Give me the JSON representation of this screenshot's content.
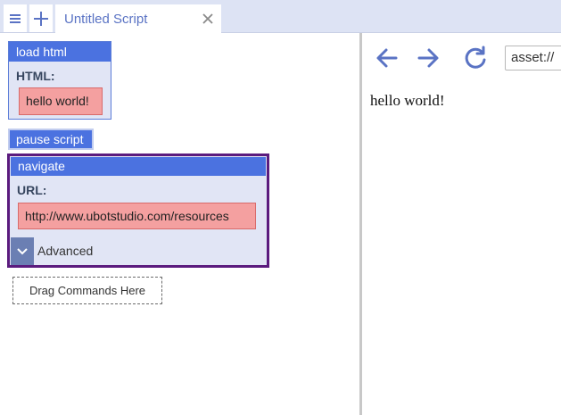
{
  "tabbar": {
    "tab_title": "Untitled Script",
    "icons": [
      "menu-icon",
      "plus-icon",
      "close-icon"
    ]
  },
  "script": {
    "load_html": {
      "header": "load html",
      "label": "HTML:",
      "value": "hello world!"
    },
    "pause_script": {
      "label": "pause script"
    },
    "navigate": {
      "header": "navigate",
      "label": "URL:",
      "value": "http://www.ubotstudio.com/resources",
      "advanced_label": "Advanced"
    },
    "drop_zone": "Drag Commands Here"
  },
  "browser": {
    "address": "asset://",
    "content_text": "hello world!",
    "icons": [
      "back-arrow-icon",
      "forward-arrow-icon",
      "reload-icon"
    ]
  },
  "colors": {
    "accent": "#4b72e0",
    "param_bg": "#f4a0a0",
    "command_bg": "#e1e5f5",
    "selected_border": "#5b1b7e",
    "icon_blue": "#5a73c4"
  }
}
